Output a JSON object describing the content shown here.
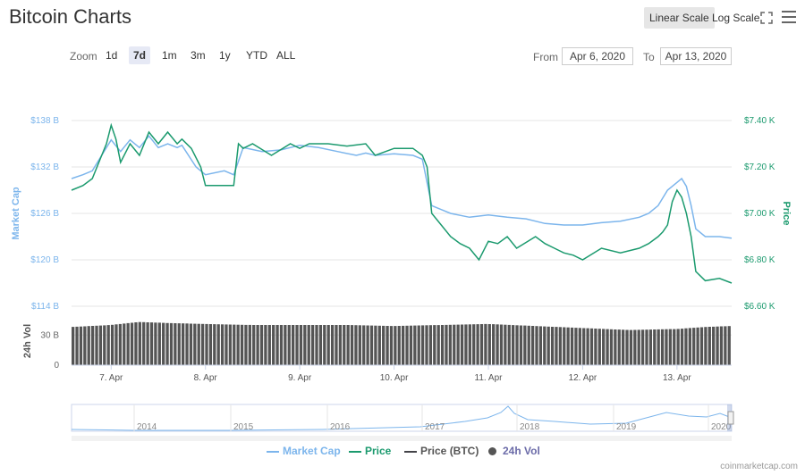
{
  "header": {
    "title": "Bitcoin Charts",
    "linear_label": "Linear Scale",
    "log_label": "Log Scale"
  },
  "zoom": {
    "label": "Zoom",
    "options": [
      "1d",
      "7d",
      "1m",
      "3m",
      "1y",
      "YTD",
      "ALL"
    ],
    "active": "7d"
  },
  "range": {
    "from_label": "From",
    "from_value": "Apr 6, 2020",
    "to_label": "To",
    "to_value": "Apr 13, 2020"
  },
  "credit": "coinmarketcap.com",
  "colors": {
    "market_cap": "#7cb5ec",
    "price": "#1b9a6e",
    "price_btc": "#434348",
    "volume": "#555555",
    "grid": "#e6e6e6"
  },
  "chart_data": {
    "type": "line",
    "x_tick_labels": [
      "7. Apr",
      "8. Apr",
      "9. Apr",
      "10. Apr",
      "11. Apr",
      "12. Apr",
      "13. Apr"
    ],
    "y_left_label": "Market Cap",
    "y_left_ticks": [
      "$114 B",
      "$120 B",
      "$126 B",
      "$132 B",
      "$138 B"
    ],
    "y_left_range": [
      114,
      138
    ],
    "y_right_label": "Price",
    "y_right_ticks": [
      "$6.60 K",
      "$6.80 K",
      "$7.00 K",
      "$7.20 K",
      "$7.40 K"
    ],
    "y_right_range": [
      6.6,
      7.4
    ],
    "vol_label": "24h Vol",
    "vol_ticks": [
      "0",
      "30 B"
    ],
    "x_range_days": [
      6.58,
      13.58
    ],
    "series": [
      {
        "name": "Market Cap",
        "x": [
          6.58,
          6.7,
          6.8,
          6.9,
          7.0,
          7.1,
          7.2,
          7.3,
          7.4,
          7.5,
          7.6,
          7.7,
          7.75,
          7.9,
          7.95,
          8.0,
          8.2,
          8.3,
          8.4,
          8.6,
          8.8,
          9.0,
          9.2,
          9.4,
          9.6,
          9.7,
          9.8,
          10.0,
          10.2,
          10.3,
          10.4,
          10.5,
          10.6,
          10.8,
          11.0,
          11.2,
          11.4,
          11.6,
          11.8,
          12.0,
          12.2,
          12.4,
          12.6,
          12.7,
          12.8,
          12.9,
          13.0,
          13.05,
          13.1,
          13.15,
          13.2,
          13.3,
          13.45,
          13.58
        ],
        "values": [
          130.5,
          131.0,
          131.5,
          133.5,
          135.5,
          134.0,
          135.5,
          134.5,
          136.0,
          134.5,
          135.0,
          134.5,
          134.8,
          132.0,
          131.5,
          131.0,
          131.5,
          131.0,
          134.5,
          134.0,
          134.2,
          134.8,
          134.5,
          134.0,
          133.5,
          133.8,
          133.5,
          133.7,
          133.5,
          133.0,
          127.0,
          126.5,
          126.0,
          125.5,
          125.8,
          125.5,
          125.3,
          124.7,
          124.5,
          124.5,
          124.8,
          125.0,
          125.5,
          126.0,
          127.0,
          129.0,
          130.0,
          130.5,
          129.5,
          127.0,
          124.0,
          123.0,
          123.0,
          122.8
        ]
      },
      {
        "name": "Price",
        "x": [
          6.58,
          6.7,
          6.8,
          6.9,
          6.95,
          7.0,
          7.05,
          7.1,
          7.2,
          7.3,
          7.4,
          7.5,
          7.6,
          7.7,
          7.75,
          7.85,
          7.95,
          8.0,
          8.2,
          8.3,
          8.35,
          8.4,
          8.5,
          8.7,
          8.9,
          9.0,
          9.1,
          9.3,
          9.5,
          9.7,
          9.8,
          10.0,
          10.2,
          10.3,
          10.35,
          10.4,
          10.5,
          10.6,
          10.7,
          10.8,
          10.9,
          11.0,
          11.1,
          11.2,
          11.3,
          11.5,
          11.6,
          11.7,
          11.8,
          11.9,
          12.0,
          12.2,
          12.4,
          12.6,
          12.7,
          12.8,
          12.85,
          12.9,
          12.95,
          13.0,
          13.05,
          13.1,
          13.15,
          13.2,
          13.3,
          13.45,
          13.58
        ],
        "values": [
          7.1,
          7.12,
          7.15,
          7.25,
          7.3,
          7.38,
          7.32,
          7.22,
          7.3,
          7.25,
          7.35,
          7.3,
          7.35,
          7.3,
          7.32,
          7.28,
          7.2,
          7.12,
          7.12,
          7.12,
          7.3,
          7.28,
          7.3,
          7.25,
          7.3,
          7.28,
          7.3,
          7.3,
          7.29,
          7.3,
          7.25,
          7.28,
          7.28,
          7.25,
          7.2,
          7.0,
          6.95,
          6.9,
          6.87,
          6.85,
          6.8,
          6.88,
          6.87,
          6.9,
          6.85,
          6.9,
          6.87,
          6.85,
          6.83,
          6.82,
          6.8,
          6.85,
          6.83,
          6.85,
          6.87,
          6.9,
          6.92,
          6.95,
          7.05,
          7.1,
          7.07,
          7.0,
          6.9,
          6.75,
          6.71,
          6.72,
          6.7
        ]
      }
    ],
    "volume": {
      "name": "24h Vol",
      "x": [
        6.58,
        7.0,
        7.3,
        7.6,
        8.0,
        8.5,
        9.0,
        9.5,
        10.0,
        10.5,
        11.0,
        11.5,
        12.0,
        12.5,
        13.0,
        13.3,
        13.58
      ],
      "values": [
        38,
        40,
        43,
        42,
        41,
        40,
        40,
        40,
        39,
        40,
        41,
        39,
        37,
        35,
        36,
        38,
        39
      ]
    },
    "navigator": {
      "year_labels": [
        "2014",
        "2015",
        "2016",
        "2017",
        "2018",
        "2019",
        "2020"
      ]
    },
    "legend": [
      "Market Cap",
      "Price",
      "Price (BTC)",
      "24h Vol"
    ]
  }
}
